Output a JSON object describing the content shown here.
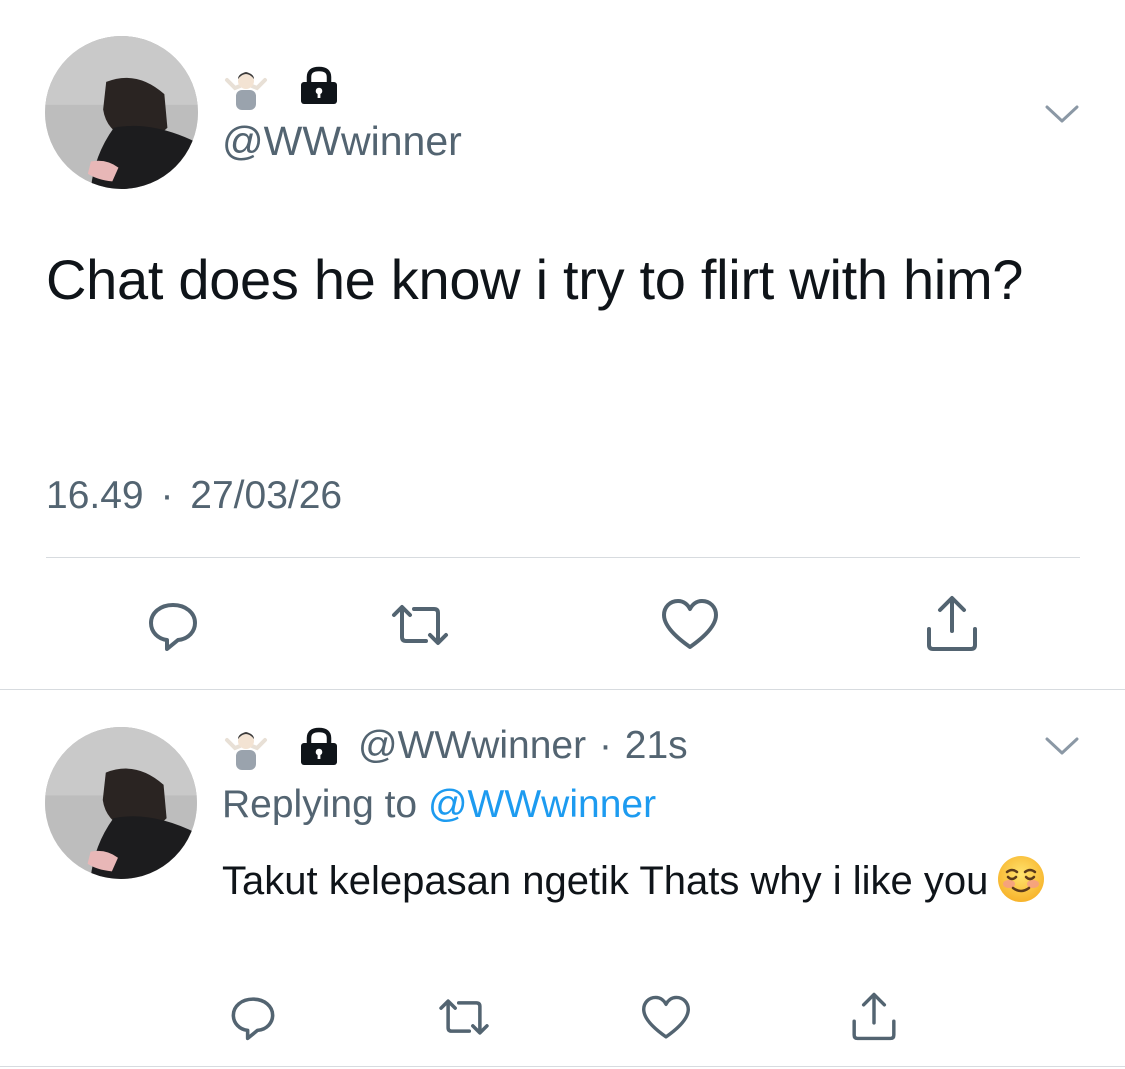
{
  "main_tweet": {
    "name_emojis": [
      "shrug-emoji",
      "lock-emoji"
    ],
    "handle": "@WWwinner",
    "text": "Chat does he know i try to flirt with him?",
    "time": "16.49",
    "separator": "·",
    "date": "27/03/26",
    "actions": [
      "reply-icon",
      "retweet-icon",
      "like-icon",
      "share-icon"
    ]
  },
  "reply_tweet": {
    "name_emojis": [
      "shrug-emoji",
      "lock-emoji"
    ],
    "handle": "@WWwinner",
    "separator": "·",
    "age": "21s",
    "replying_to_label": "Replying to",
    "replying_to_handle": "@WWwinner",
    "text": "Takut kelepasan ngetik Thats why i like you",
    "trailing_emoji": "smiling-face-emoji",
    "actions": [
      "reply-icon",
      "retweet-icon",
      "like-icon",
      "share-icon"
    ]
  },
  "colors": {
    "text": "#0f1419",
    "secondary": "#536471",
    "link": "#1d9bf0",
    "divider": "#d7dbdf",
    "icon": "#536471"
  }
}
